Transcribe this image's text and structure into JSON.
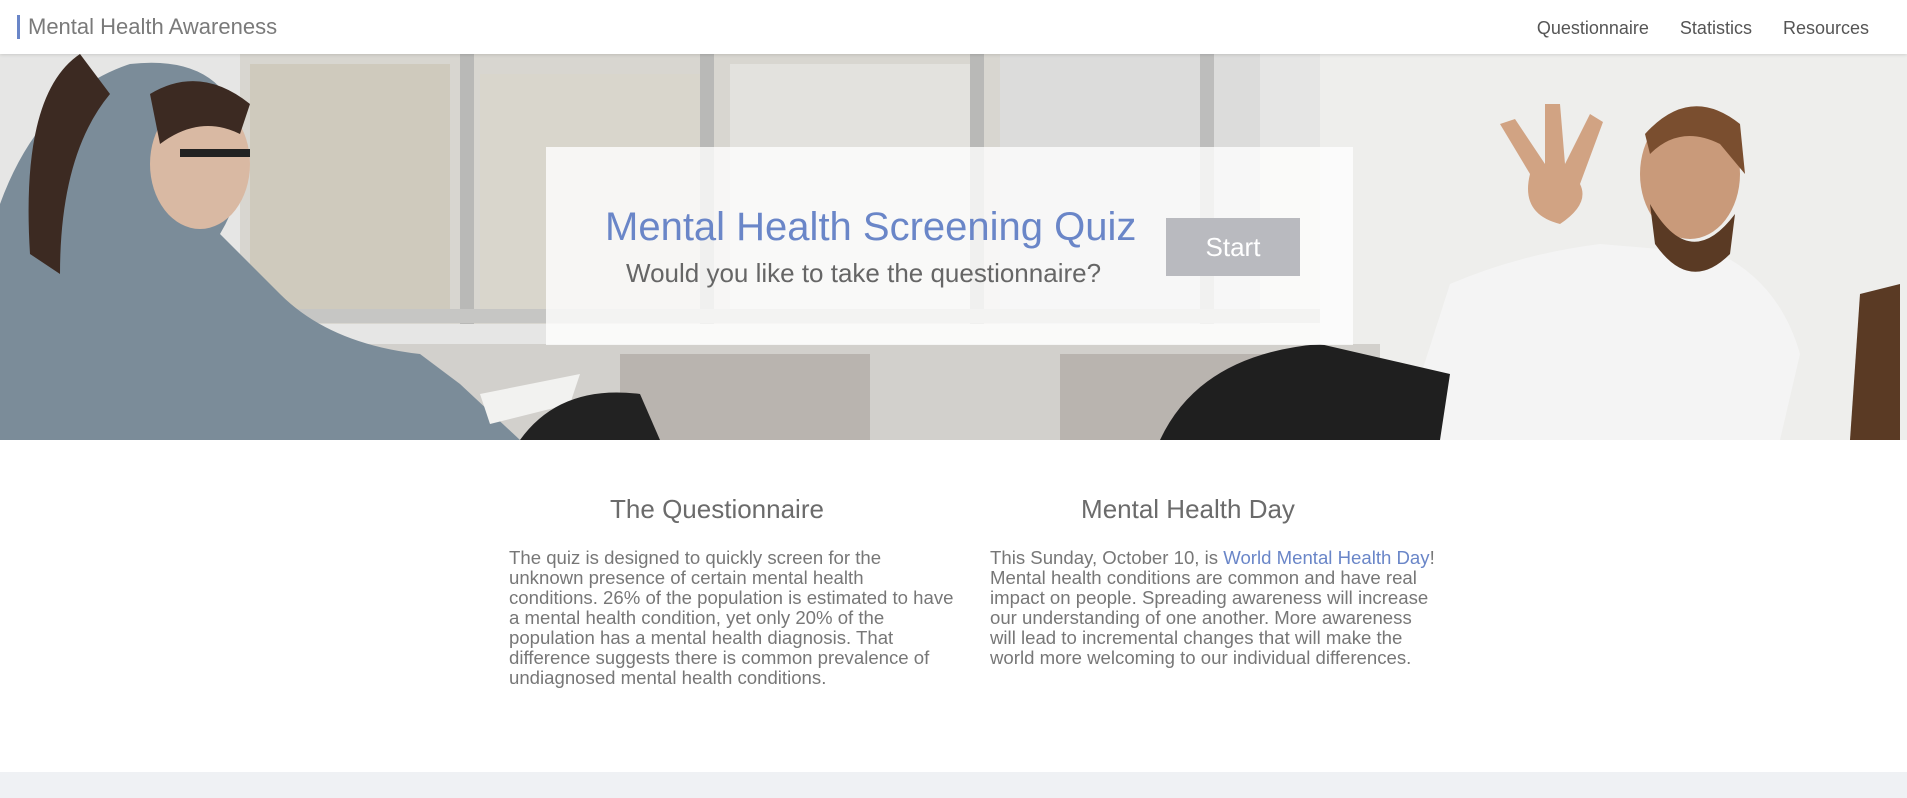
{
  "brand": {
    "title": "Mental Health Awareness"
  },
  "nav": {
    "items": [
      "Questionnaire",
      "Statistics",
      "Resources"
    ]
  },
  "hero": {
    "title": "Mental Health Screening Quiz",
    "subtitle": "Would you like to take the questionnaire?",
    "button_label": "Start"
  },
  "sections": {
    "questionnaire": {
      "heading": "The Questionnaire",
      "body": "The quiz is designed to quickly screen for the unknown presence of certain mental health conditions. 26% of the population is estimated to have a mental health condition, yet only 20% of the population has a mental health diagnosis. That difference suggests there is common prevalence of undiagnosed mental health conditions."
    },
    "health_day": {
      "heading": "Mental Health Day",
      "body_before": "This Sunday, October 10, is ",
      "link_text": "World Mental Health Day",
      "body_after": "! Mental health conditions are common and have real impact on people. Spreading awareness will increase our understanding of one another. More awareness will lead to incremental changes that will make the world more welcoming to our individual differences."
    }
  },
  "colors": {
    "accent": "#6a86c8",
    "button": "#b9babf",
    "footer": "#eff1f4"
  }
}
